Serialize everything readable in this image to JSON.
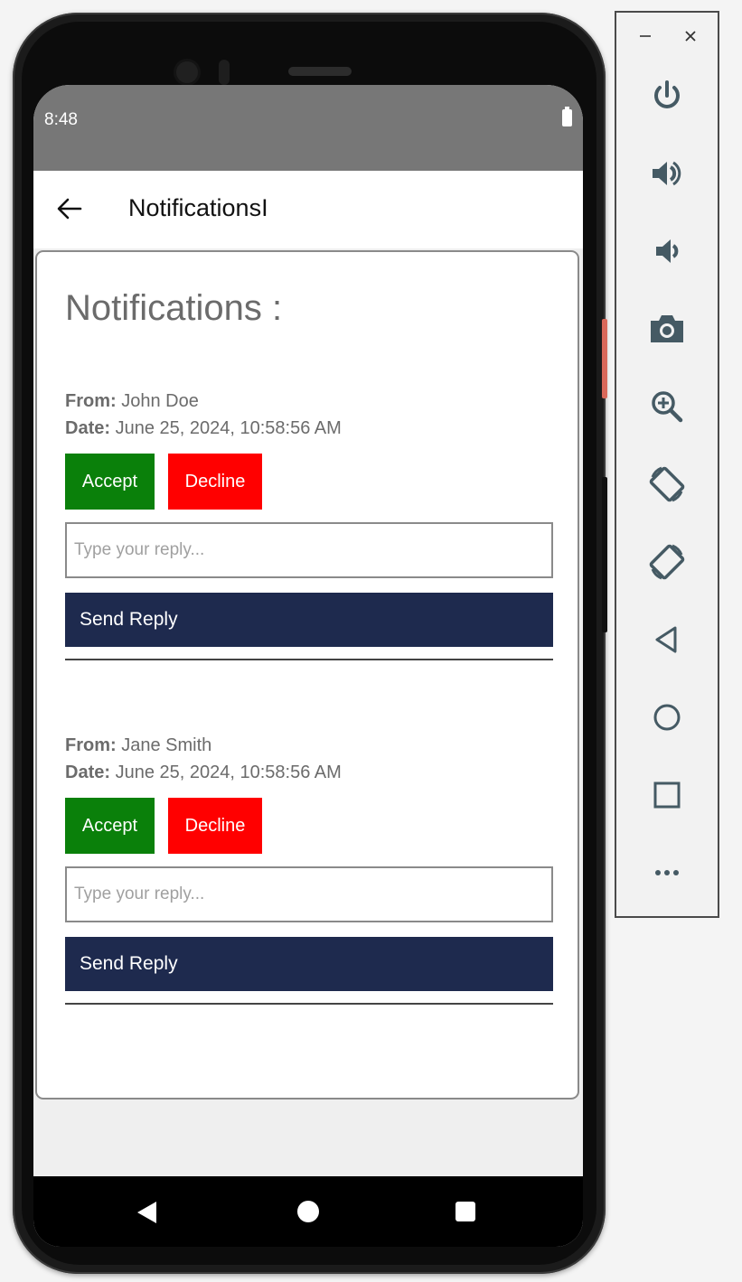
{
  "status_bar": {
    "time": "8:48"
  },
  "app_bar": {
    "title": "NotificationsI"
  },
  "card": {
    "title": "Notifications :"
  },
  "notifications": [
    {
      "from_label": "From:",
      "from": "John Doe",
      "date_label": "Date:",
      "date": "June 25, 2024, 10:58:56 AM",
      "accept_label": "Accept",
      "decline_label": "Decline",
      "reply_placeholder": "Type your reply...",
      "send_label": "Send Reply"
    },
    {
      "from_label": "From:",
      "from": "Jane Smith",
      "date_label": "Date:",
      "date": "June 25, 2024, 10:58:56 AM",
      "accept_label": "Accept",
      "decline_label": "Decline",
      "reply_placeholder": "Type your reply...",
      "send_label": "Send Reply"
    }
  ],
  "colors": {
    "accept": "#0a800a",
    "decline": "#ff0000",
    "send": "#1e2a4e",
    "status_bar": "#777777"
  },
  "emulator_toolbar": {
    "window_controls": [
      "minimize-icon",
      "close-icon"
    ],
    "buttons": [
      "power-icon",
      "volume-up-icon",
      "volume-down-icon",
      "camera-icon",
      "zoom-icon",
      "rotate-left-icon",
      "rotate-right-icon",
      "back-icon",
      "home-icon",
      "overview-icon",
      "more-icon"
    ]
  }
}
